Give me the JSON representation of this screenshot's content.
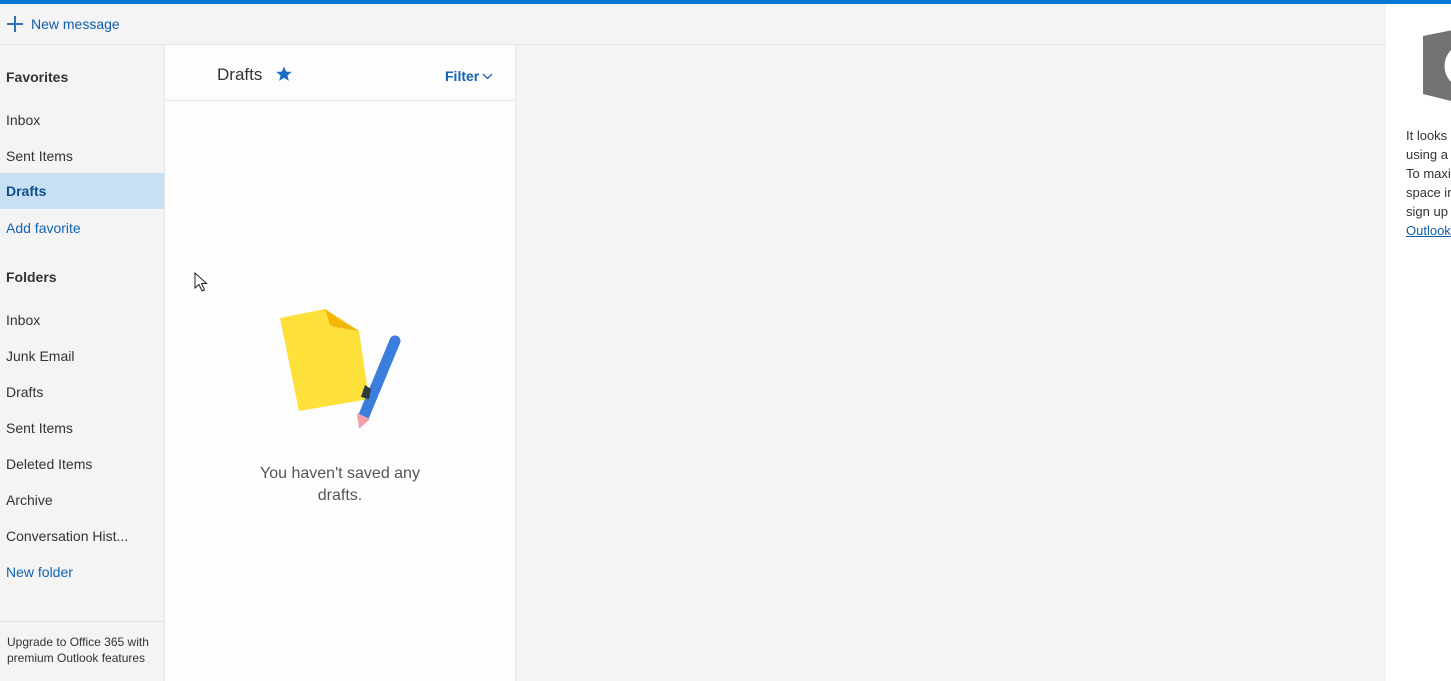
{
  "command_bar": {
    "new_message_label": "New message"
  },
  "sidebar": {
    "favorites_header": "Favorites",
    "favorites": [
      {
        "label": "Inbox"
      },
      {
        "label": "Sent Items"
      },
      {
        "label": "Drafts",
        "selected": true
      },
      {
        "label": "Add favorite",
        "link": true
      }
    ],
    "folders_header": "Folders",
    "folders": [
      {
        "label": "Inbox"
      },
      {
        "label": "Junk Email"
      },
      {
        "label": "Drafts"
      },
      {
        "label": "Sent Items"
      },
      {
        "label": "Deleted Items"
      },
      {
        "label": "Archive"
      },
      {
        "label": "Conversation Hist..."
      },
      {
        "label": "New folder",
        "link": true
      }
    ],
    "upgrade_text": "Upgrade to Office 365 with premium Outlook features"
  },
  "message_list": {
    "title": "Drafts",
    "filter_label": "Filter",
    "empty_message": "You haven't saved any drafts."
  },
  "right_pane": {
    "promo_lines": [
      "It looks",
      "using a",
      "To maxi",
      "space ir",
      "sign up"
    ],
    "promo_link": "Outlook"
  },
  "colors": {
    "accent": "#0078d4",
    "selected_bg": "#c7e0f4",
    "link": "#1164b4"
  },
  "icons": {
    "new_message": "plus-icon",
    "favorite": "star-icon",
    "filter": "chevron-down-icon",
    "empty_state": "draft-paper-pencil-illustration",
    "office": "office-logo-icon"
  }
}
